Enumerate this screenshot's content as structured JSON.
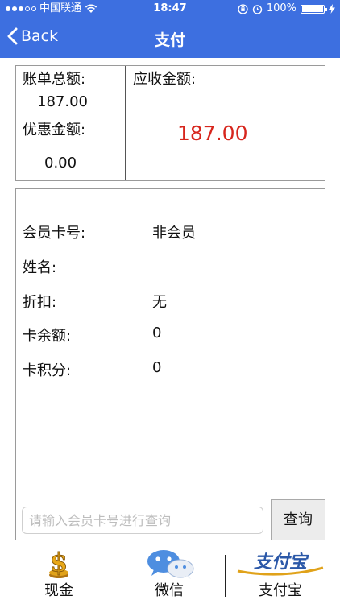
{
  "status_bar": {
    "carrier": "中国联通",
    "time": "18:47",
    "battery": "100%"
  },
  "nav": {
    "back_label": "Back",
    "title": "支付"
  },
  "amounts": {
    "bill_total_label": "账单总额:",
    "bill_total_value": "187.00",
    "discount_label": "优惠金额:",
    "discount_value": "0.00",
    "receivable_label": "应收金额:",
    "receivable_value": "187.00"
  },
  "member": {
    "rows": [
      {
        "label": "会员卡号:",
        "value": "非会员"
      },
      {
        "label": "姓名:",
        "value": ""
      },
      {
        "label": "折扣:",
        "value": "无"
      },
      {
        "label": "卡余额:",
        "value": "0"
      },
      {
        "label": "卡积分:",
        "value": "0"
      }
    ],
    "search_placeholder": "请输入会员卡号进行查询",
    "search_value": "",
    "query_label": "查询"
  },
  "pay_tabs": [
    {
      "label": "现金",
      "icon": "cash-dollar-icon"
    },
    {
      "label": "微信",
      "icon": "wechat-icon"
    },
    {
      "label": "支付宝",
      "icon": "alipay-logo-icon",
      "logo_text": "支付宝"
    }
  ],
  "colors": {
    "nav_bg": "#3d6fe0",
    "receivable": "#d7261d",
    "alipay": "#2b58a8",
    "cash_gold": "#e0a21a"
  }
}
